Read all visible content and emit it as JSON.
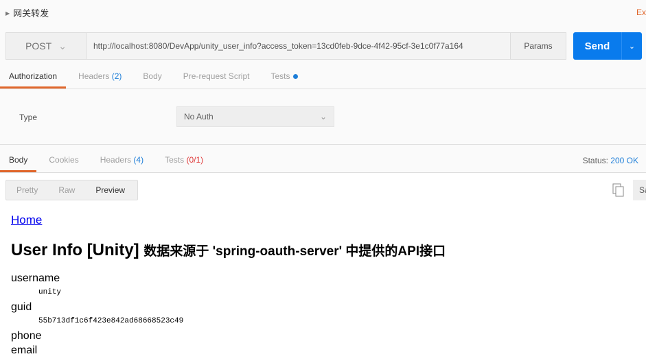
{
  "header": {
    "title": "网关转发",
    "right_text": "Ex"
  },
  "request": {
    "method": "POST",
    "url": "http://localhost:8080/DevApp/unity_user_info?access_token=13cd0feb-9dce-4f42-95cf-3e1c0f77a164",
    "params_label": "Params",
    "send_label": "Send"
  },
  "req_tabs": [
    {
      "label": "Authorization"
    },
    {
      "label": "Headers",
      "count": "(2)"
    },
    {
      "label": "Body"
    },
    {
      "label": "Pre-request Script"
    },
    {
      "label": "Tests"
    }
  ],
  "auth": {
    "type_label": "Type",
    "type_value": "No Auth"
  },
  "resp_tabs": [
    {
      "label": "Body"
    },
    {
      "label": "Cookies"
    },
    {
      "label": "Headers",
      "count": "(4)"
    },
    {
      "label": "Tests",
      "count": "(0/1)"
    }
  ],
  "status": {
    "label": "Status:",
    "value": "200 OK"
  },
  "view_modes": [
    "Pretty",
    "Raw",
    "Preview"
  ],
  "save_label": "Sa",
  "preview": {
    "home_link": "Home",
    "heading": "User Info [Unity]",
    "heading_sub": "数据来源于 'spring-oauth-server' 中提供的API接口",
    "fields": [
      {
        "name": "username",
        "value": "unity"
      },
      {
        "name": "guid",
        "value": "55b713df1c6f423e842ad68668523c49"
      },
      {
        "name": "phone",
        "value": ""
      },
      {
        "name": "email",
        "value": ""
      }
    ]
  },
  "colors": {
    "accent": "#e0662b",
    "send": "#097bed",
    "link": "#1e7ed8"
  }
}
